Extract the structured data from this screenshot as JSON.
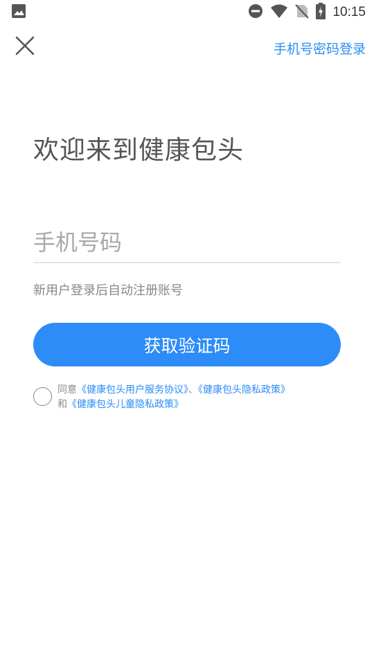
{
  "status_bar": {
    "time": "10:15",
    "icons": [
      "image-icon",
      "do-not-disturb-icon",
      "wifi-icon",
      "no-sim-icon",
      "battery-charging-icon"
    ]
  },
  "header": {
    "close_icon": "close-icon",
    "password_login_label": "手机号密码登录"
  },
  "main": {
    "welcome_title": "欢迎来到健康包头",
    "phone_input": {
      "placeholder": "手机号码",
      "value": ""
    },
    "hint": "新用户登录后自动注册账号",
    "get_code_label": "获取验证码"
  },
  "agreement": {
    "checked": false,
    "prefix": "同意",
    "user_agreement": "《健康包头用户服务协议》",
    "separator": "、",
    "privacy_policy": "《健康包头隐私政策》",
    "and": "和",
    "child_privacy_policy": "《健康包头儿童隐私政策》"
  },
  "colors": {
    "accent": "#2d8cf8",
    "link": "#2b8cf5",
    "title": "#555555",
    "hint": "#888888"
  }
}
